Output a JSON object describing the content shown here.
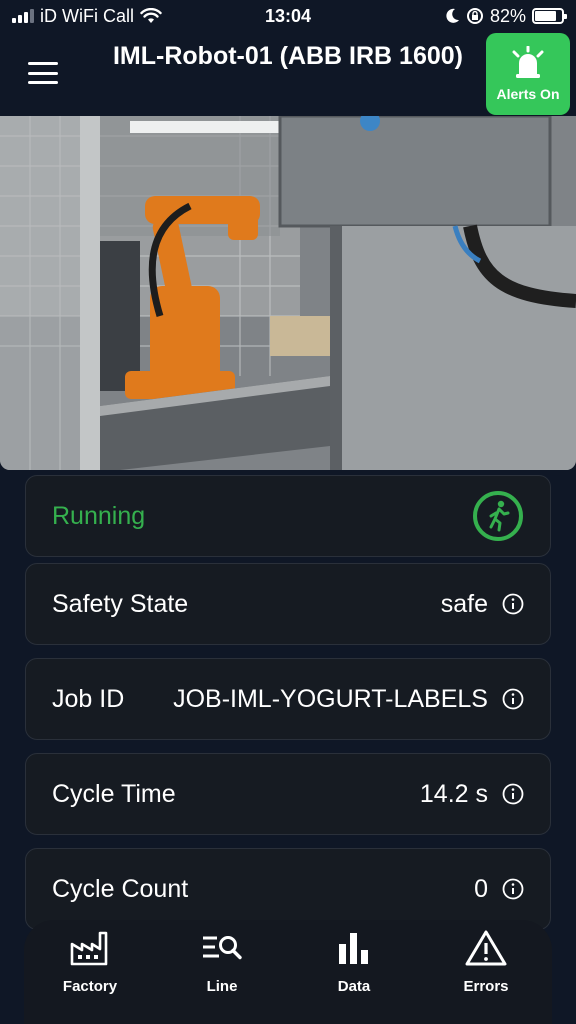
{
  "status_bar": {
    "carrier": "iD WiFi Call",
    "time": "13:04",
    "battery": "82%",
    "battery_level": 0.82
  },
  "header": {
    "title": "IML-Robot-01 (ABB IRB 1600)",
    "menu_icon": "hamburger-menu-icon",
    "alerts_label": "Alerts On",
    "alerts_icon": "alarm-bell-icon",
    "alerts_color": "#35c75a"
  },
  "status": {
    "label": "Running",
    "color": "#35b04e",
    "icon": "running-person-icon"
  },
  "fields": [
    {
      "label": "Safety State",
      "value": "safe"
    },
    {
      "label": "Job ID",
      "value": "JOB-IML-YOGURT-LABELS"
    },
    {
      "label": "Cycle Time",
      "value": "14.2 s"
    },
    {
      "label": "Cycle Count",
      "value": "0"
    }
  ],
  "nav": [
    {
      "label": "Factory",
      "icon": "factory-icon"
    },
    {
      "label": "Line",
      "icon": "line-search-icon"
    },
    {
      "label": "Data",
      "icon": "bar-chart-icon"
    },
    {
      "label": "Errors",
      "icon": "warning-triangle-icon"
    }
  ],
  "colors": {
    "background": "#0f1726",
    "card": "#161b22",
    "accent_green": "#35c75a"
  }
}
